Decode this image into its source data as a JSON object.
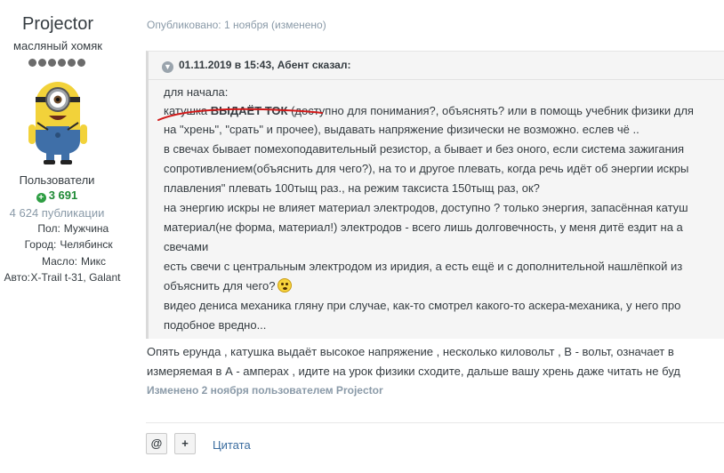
{
  "author": {
    "name": "Projector",
    "rank": "масляный хомяк",
    "rank_level": 6,
    "group": "Пользователи",
    "reputation": "3 691",
    "posts": "4 624 публикации",
    "info": [
      {
        "key": "Пол:",
        "value": "Мужчина"
      },
      {
        "key": "Город:",
        "value": "Челябинск"
      },
      {
        "key": "Масло:",
        "value": "Микс"
      },
      {
        "key": "Авто:",
        "value": "X-Trail t-31, Galant"
      }
    ]
  },
  "post": {
    "meta": "Опубликовано: 1 ноября (изменено)",
    "quote": {
      "header": "01.11.2019 в 15:43, Абент сказал:",
      "lines": {
        "l1": "для начала:",
        "l2a": "катушка ",
        "l2b": "ВЫДАЁТ ТОК",
        "l2c": " (доступно для понимания?, объяснять?  или в помощь учебник физики для",
        "l3": "на \"хрень\", \"срать\" и прочее), выдавать напряжение физически не возможно. еслев чё ..",
        "l4": "в свечах бывает помехоподавительный резистор, а бывает и без  оного, если система зажигания",
        "l5": "сопротивлением(объяснить для чего?), на то и другое плевать, когда речь идёт об энергии искры",
        "l6": "плавления\"  плевать 100тыщ раз., на режим таксиста 150тыщ раз,  ок?",
        "l7": "на энергию искры не влияет материал электродов, доступно ? только энергия, запасённая катуш",
        "l8": "материал(не форма, материал!) электродов - всего лишь долговечность, у меня дитё ездит на а",
        "l9": "свечами",
        "l10": "есть свечи с центральным электродом из иридия, а есть ещё и с дополнительной нашлёпкой из",
        "l11": "объяснить для чего?",
        "l12": "видео дениса механика гляну при случае, как-то смотрел какого-то аскера-механика, у него про",
        "l13": "подобное вредно..."
      }
    },
    "body": {
      "line1": "Опять ерунда , катушка выдаёт высокое напряжение , несколько киловольт , В - вольт,  означает в",
      "line2": "измеряемая в А - амперах , идите на урок физики сходите,  дальше вашу хрень даже читать не буд"
    },
    "edited": "Изменено 2 ноября пользователем Projector",
    "actions": {
      "mention_icon": "@",
      "add_icon": "+",
      "quote_label": "Цитата"
    }
  },
  "colors": {
    "reputation": "#1e8a35",
    "muted": "#8a9aa8",
    "link": "#3a6c9f",
    "annotation_red": "#d11a1a"
  }
}
